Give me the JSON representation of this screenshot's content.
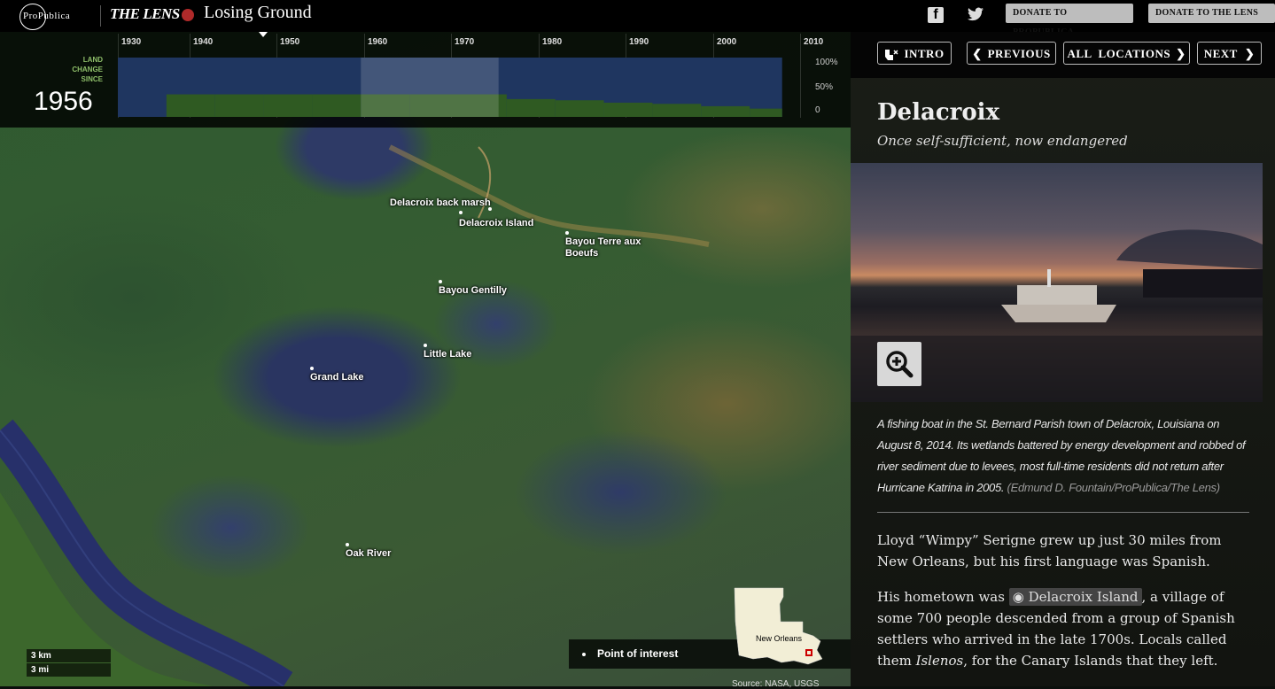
{
  "header": {
    "propublica_logo": "ProPublica",
    "lens_logo": "THE LENS",
    "app_title": "Losing Ground",
    "donate_propublica": "DONATE TO PROPUBLICA",
    "donate_lens": "DONATE TO THE LENS",
    "social": [
      "facebook-icon",
      "twitter-icon"
    ]
  },
  "timeline": {
    "label": "LAND CHANGE SINCE",
    "current_year": "1956",
    "ticks": [
      "1930",
      "1940",
      "1950",
      "1960",
      "1970",
      "1980",
      "1990",
      "2000",
      "2010"
    ],
    "pct_labels": [
      "100%",
      "50%",
      "0"
    ]
  },
  "chart_data": {
    "type": "area",
    "xlabel": "",
    "ylabel": "LAND CHANGE SINCE",
    "x": [
      1932,
      1938,
      1944,
      1950,
      1956,
      1962,
      1968,
      1974,
      1980,
      1986,
      1992,
      1998,
      2004,
      2008
    ],
    "series": [
      {
        "values": [
          38,
          38,
          38,
          38,
          38,
          38,
          38,
          30,
          28,
          24,
          22,
          18,
          14,
          10
        ]
      }
    ],
    "highlight_range": [
      1956,
      1973
    ],
    "ylim": [
      0,
      100
    ]
  },
  "map": {
    "points_of_interest": [
      "Delacroix back marsh",
      "Delacroix Island",
      "Bayou Terre aux\nBoeufs",
      "Bayou Gentilly",
      "Little Lake",
      "Grand Lake",
      "Oak River"
    ],
    "scale": [
      "3 km",
      "3 mi"
    ],
    "legend": "Point of interest",
    "inset_label": "New Orleans",
    "source": "Source: NASA, USGS"
  },
  "nav": {
    "intro": "INTRO",
    "previous": "PREVIOUS",
    "all_locations": "ALL  LOCATIONS",
    "next": "NEXT"
  },
  "location": {
    "title": "Delacroix",
    "subtitle": "Once self-sufficient, now endangered",
    "caption": "A fishing boat in the St. Bernard Parish town of Delacroix, Louisiana on August 8, 2014. Its wetlands battered by energy development and robbed of river sediment due to levees, most full-time residents did not return after Hurricane Katrina in 2005.",
    "credit": "(Edmund D. Fountain/ProPublica/The Lens)",
    "para1": "Lloyd “Wimpy” Serigne grew up just 30 miles from New Orleans, but his first language was Spanish.",
    "para2_pre": "His hometown was ",
    "para2_link": "Delacroix Island",
    "para2_mid": ", a village of some 700 people descended from a group of Spanish settlers who arrived in the late 1700s. Locals called them ",
    "para2_em": "Islenos",
    "para2_post": ", for the Canary Islands that they left."
  }
}
